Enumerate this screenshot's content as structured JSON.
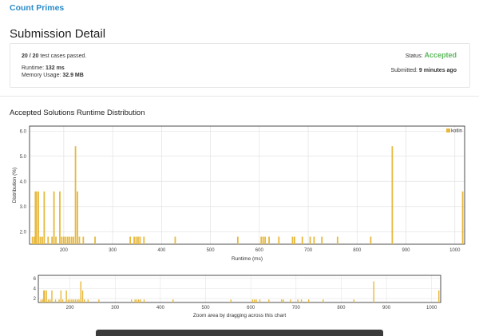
{
  "problem": {
    "title": "Count Primes"
  },
  "page": {
    "title": "Submission Detail"
  },
  "submission": {
    "cases_passed": "20 / 20",
    "cases_suffix": "test cases passed.",
    "status_label": "Status:",
    "status_value": "Accepted",
    "runtime_label": "Runtime:",
    "runtime_value": "132 ms",
    "memory_label": "Memory Usage:",
    "memory_value": "32.9 MB",
    "submitted_label": "Submitted:",
    "submitted_value": "9 minutes ago"
  },
  "section": {
    "title": "Accepted Solutions Runtime Distribution"
  },
  "chart_data": [
    {
      "type": "bar",
      "title": "",
      "xlabel": "Runtime (ms)",
      "ylabel": "Distribution (%)",
      "xlim": [
        130,
        1020
      ],
      "ylim": [
        1.5,
        6.2
      ],
      "x_ticks": [
        200,
        300,
        400,
        500,
        600,
        700,
        800,
        900,
        1000
      ],
      "y_ticks": [
        "2.0",
        "3.0",
        "4.0",
        "5.0",
        "6.0"
      ],
      "legend": "top-right",
      "grid": true,
      "series": [
        {
          "name": "kotlin",
          "color": "#e7b83c",
          "x": [
            136,
            140,
            142,
            144,
            148,
            152,
            156,
            160,
            168,
            176,
            180,
            184,
            192,
            196,
            200,
            204,
            208,
            212,
            216,
            220,
            224,
            228,
            232,
            240,
            264,
            336,
            344,
            348,
            352,
            356,
            364,
            428,
            556,
            604,
            608,
            612,
            620,
            640,
            668,
            672,
            688,
            704,
            712,
            728,
            760,
            828,
            872,
            1016
          ],
          "values": [
            1.8,
            1.8,
            3.6,
            3.6,
            3.6,
            1.8,
            1.8,
            3.6,
            1.8,
            1.8,
            3.6,
            1.8,
            3.6,
            1.8,
            1.8,
            1.8,
            1.8,
            1.8,
            1.8,
            1.8,
            5.4,
            3.6,
            1.8,
            1.8,
            1.8,
            1.8,
            1.8,
            1.8,
            1.8,
            1.8,
            1.8,
            1.8,
            1.8,
            1.8,
            1.8,
            1.8,
            1.8,
            1.8,
            1.8,
            1.8,
            1.8,
            1.8,
            1.8,
            1.8,
            1.8,
            1.8,
            5.4,
            3.6
          ]
        }
      ]
    },
    {
      "type": "bar",
      "title": "",
      "xlabel": "Zoom area by dragging across this chart",
      "ylabel": "",
      "xlim": [
        130,
        1020
      ],
      "ylim": [
        1.5,
        6.2
      ],
      "x_ticks": [
        200,
        300,
        400,
        500,
        600,
        700,
        800,
        900,
        1000
      ],
      "y_ticks": [
        "2",
        "4",
        "6"
      ],
      "grid": true
    }
  ]
}
